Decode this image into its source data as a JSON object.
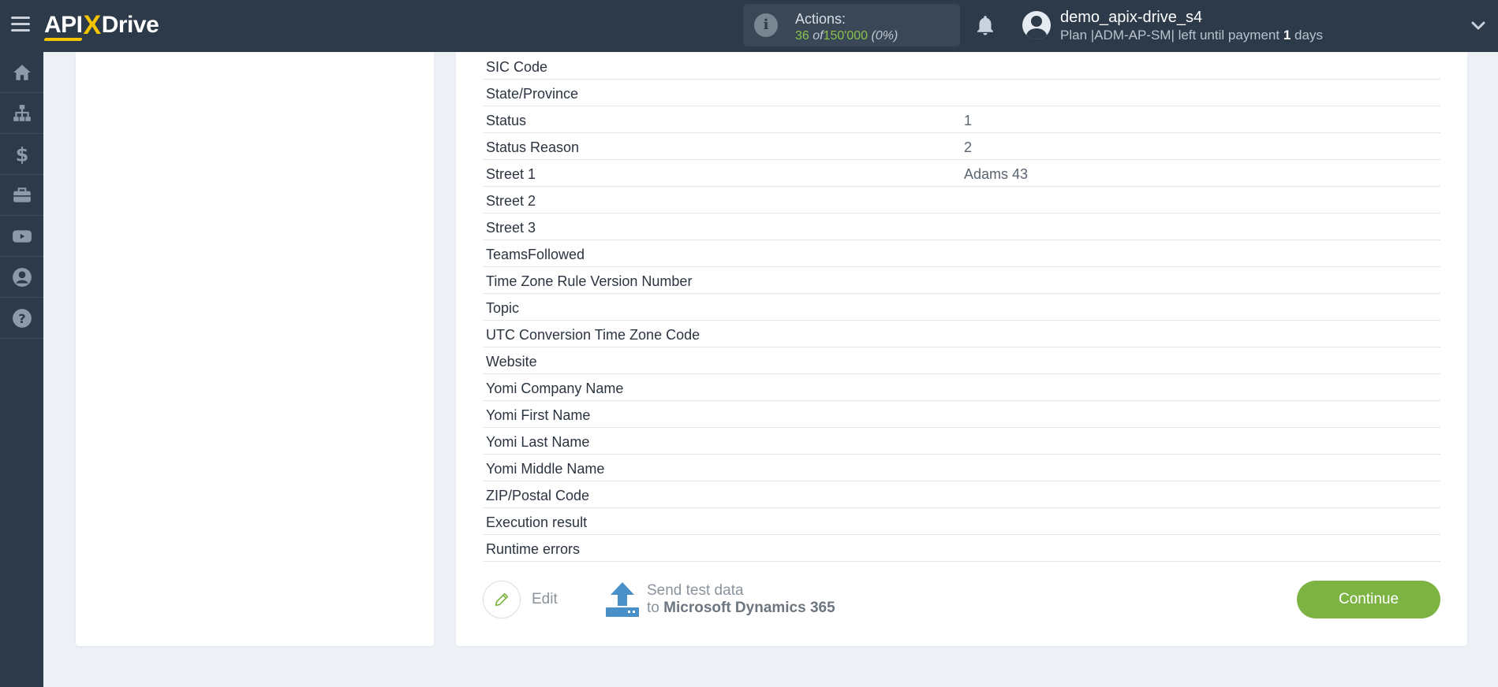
{
  "header": {
    "logo_left": "API",
    "logo_x": "X",
    "logo_right": "Drive",
    "actions_label": "Actions:",
    "actions_used": "36",
    "actions_of": "of",
    "actions_total": "150'000",
    "actions_pct": "(0%)",
    "username": "demo_apix-drive_s4",
    "plan_prefix": "Plan |ADM-AP-SM| left until payment",
    "plan_days_num": "1",
    "plan_days_label": "days"
  },
  "sidebar": {
    "items": [
      {
        "icon": "home-icon"
      },
      {
        "icon": "sitemap-icon"
      },
      {
        "icon": "dollar-icon"
      },
      {
        "icon": "briefcase-icon"
      },
      {
        "icon": "youtube-icon"
      },
      {
        "icon": "user-icon"
      },
      {
        "icon": "help-icon"
      }
    ]
  },
  "fields": [
    {
      "name": "SIC Code",
      "value": ""
    },
    {
      "name": "State/Province",
      "value": ""
    },
    {
      "name": "Status",
      "value": "1"
    },
    {
      "name": "Status Reason",
      "value": "2"
    },
    {
      "name": "Street 1",
      "value": "Adams 43"
    },
    {
      "name": "Street 2",
      "value": ""
    },
    {
      "name": "Street 3",
      "value": ""
    },
    {
      "name": "TeamsFollowed",
      "value": ""
    },
    {
      "name": "Time Zone Rule Version Number",
      "value": ""
    },
    {
      "name": "Topic",
      "value": ""
    },
    {
      "name": "UTC Conversion Time Zone Code",
      "value": ""
    },
    {
      "name": "Website",
      "value": ""
    },
    {
      "name": "Yomi Company Name",
      "value": ""
    },
    {
      "name": "Yomi First Name",
      "value": ""
    },
    {
      "name": "Yomi Last Name",
      "value": ""
    },
    {
      "name": "Yomi Middle Name",
      "value": ""
    },
    {
      "name": "ZIP/Postal Code",
      "value": ""
    },
    {
      "name": "Execution result",
      "value": ""
    },
    {
      "name": "Runtime errors",
      "value": ""
    }
  ],
  "footer": {
    "edit_label": "Edit",
    "send_line1": "Send test data",
    "send_to": "to",
    "send_target": "Microsoft Dynamics 365",
    "continue_label": "Continue"
  },
  "colors": {
    "topbar": "#2c3a49",
    "accent_green": "#7cb342",
    "logo_yellow": "#f5c400",
    "upload_blue": "#4a90c8"
  }
}
